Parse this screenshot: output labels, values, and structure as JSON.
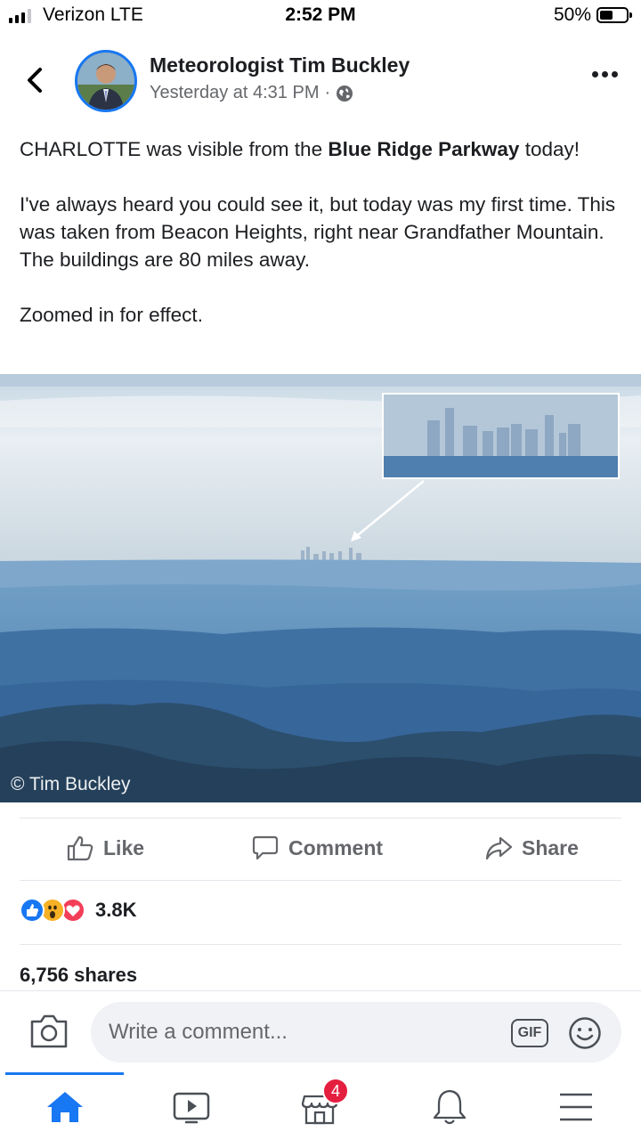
{
  "status_bar": {
    "carrier": "Verizon LTE",
    "time": "2:52 PM",
    "battery_percent": "50%",
    "battery_level": 0.5
  },
  "post": {
    "author": "Meteorologist Tim Buckley",
    "timestamp": "Yesterday at 4:31 PM",
    "separator": "·",
    "privacy_icon": "globe-icon",
    "text": {
      "p1_pre": "CHARLOTTE was visible from the ",
      "p1_bold": "Blue Ridge Parkway",
      "p1_post": " today!",
      "p2": "I've always heard you could see it, but today was my first time. This was taken from Beacon Heights, right near Grandfather Mountain. The buildings are 80 miles away.",
      "p3": "Zoomed in for effect."
    },
    "photo_credit": "© Tim Buckley"
  },
  "actions": {
    "like": "Like",
    "comment": "Comment",
    "share": "Share"
  },
  "reactions": {
    "icons": [
      "like-reaction-icon",
      "wow-reaction-icon",
      "love-reaction-icon"
    ],
    "count": "3.8K"
  },
  "shares_text": "6,756 shares",
  "composer": {
    "placeholder": "Write a comment...",
    "gif_label": "GIF"
  },
  "bottom_nav": {
    "items": [
      "home-icon",
      "watch-icon",
      "marketplace-icon",
      "notifications-icon",
      "menu-icon"
    ],
    "marketplace_badge": "4"
  },
  "colors": {
    "brand": "#1877f2",
    "text": "#1c1e21",
    "secondary_text": "#65676b",
    "badge": "#e41e3f"
  }
}
